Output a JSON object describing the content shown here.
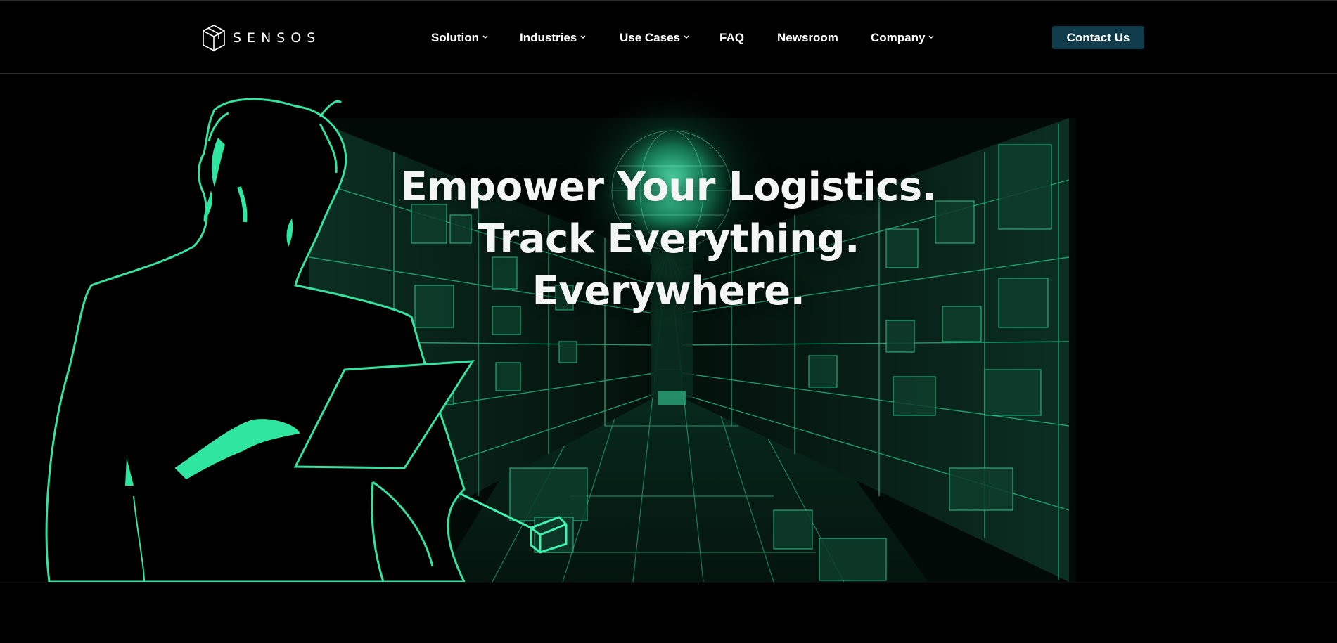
{
  "brand": {
    "name": "SENSOS",
    "logo_icon": "cube-outline-icon"
  },
  "nav": {
    "items": [
      {
        "label": "Solution",
        "has_dropdown": true
      },
      {
        "label": "Industries",
        "has_dropdown": true
      },
      {
        "label": "Use Cases",
        "has_dropdown": true
      },
      {
        "label": "FAQ",
        "has_dropdown": false
      },
      {
        "label": "Newsroom",
        "has_dropdown": false
      },
      {
        "label": "Company",
        "has_dropdown": true
      }
    ],
    "dropdown_icon": "chevron-down-icon",
    "cta_label": "Contact Us"
  },
  "hero": {
    "headline_lines": [
      "Empower Your Logistics.",
      "Track Everything.",
      "Everywhere."
    ],
    "illustration": "person-with-tablet-in-warehouse-neon-outline"
  },
  "colors": {
    "background": "#000000",
    "accent_green": "#2ee6a0",
    "cta_background": "#0f3b4a",
    "text": "#ffffff"
  }
}
